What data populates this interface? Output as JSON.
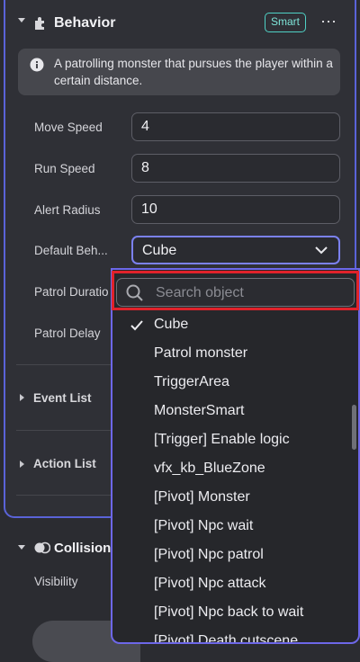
{
  "behavior": {
    "title": "Behavior",
    "badge": "Smart",
    "more": "⋯",
    "info": "A patrolling monster that pursues the player within a certain distance.",
    "fields": [
      {
        "label": "Move Speed",
        "value": "4"
      },
      {
        "label": "Run Speed",
        "value": "8"
      },
      {
        "label": "Alert Radius",
        "value": "10"
      }
    ],
    "default_behavior": {
      "label": "Default Beh...",
      "value": "Cube"
    },
    "patrol_duration_label": "Patrol Duratio",
    "patrol_delay_label": "Patrol Delay",
    "event_list": "Event List",
    "action_list": "Action List"
  },
  "collision": {
    "title": "Collision",
    "visibility_label": "Visibility"
  },
  "dropdown": {
    "search_placeholder": "Search object",
    "selected_index": 0,
    "options": [
      "Cube",
      "Patrol monster",
      "TriggerArea",
      "MonsterSmart",
      "[Trigger] Enable logic",
      "vfx_kb_BlueZone",
      "[Pivot] Monster",
      "[Pivot] Npc wait",
      "[Pivot] Npc patrol",
      "[Pivot] Npc attack",
      "[Pivot] Npc back to wait",
      "[Pivot] Death cutscene"
    ]
  },
  "colors": {
    "accent": "#6d67e8",
    "badge": "#4fd1c5",
    "highlight": "#e0222b"
  }
}
